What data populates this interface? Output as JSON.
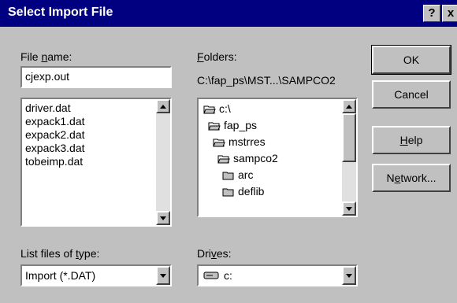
{
  "window": {
    "title": "Select Import File",
    "help_glyph": "?",
    "close_glyph": "x"
  },
  "file_name": {
    "label_pre": "File ",
    "label_key": "n",
    "label_post": "ame:",
    "value": "cjexp.out",
    "files": [
      "driver.dat",
      "expack1.dat",
      "expack2.dat",
      "expack3.dat",
      "tobeimp.dat"
    ]
  },
  "folders": {
    "label_key": "F",
    "label_post": "olders:",
    "path": "C:\\fap_ps\\MST...\\SAMPCO2",
    "items": [
      {
        "name": "c:\\",
        "open": true
      },
      {
        "name": "fap_ps",
        "open": true
      },
      {
        "name": "mstrres",
        "open": true
      },
      {
        "name": "sampco2",
        "open": true
      },
      {
        "name": "arc",
        "open": false
      },
      {
        "name": "deflib",
        "open": false
      }
    ]
  },
  "buttons": {
    "ok": "OK",
    "cancel": "Cancel",
    "help_key": "H",
    "help_post": "elp",
    "network_pre": "N",
    "network_key": "e",
    "network_post": "twork..."
  },
  "file_type": {
    "label_pre": "List files of ",
    "label_key": "t",
    "label_post": "ype:",
    "value": "Import (*.DAT)"
  },
  "drives": {
    "label_pre": "Dri",
    "label_key": "v",
    "label_post": "es:",
    "value": "c:"
  }
}
